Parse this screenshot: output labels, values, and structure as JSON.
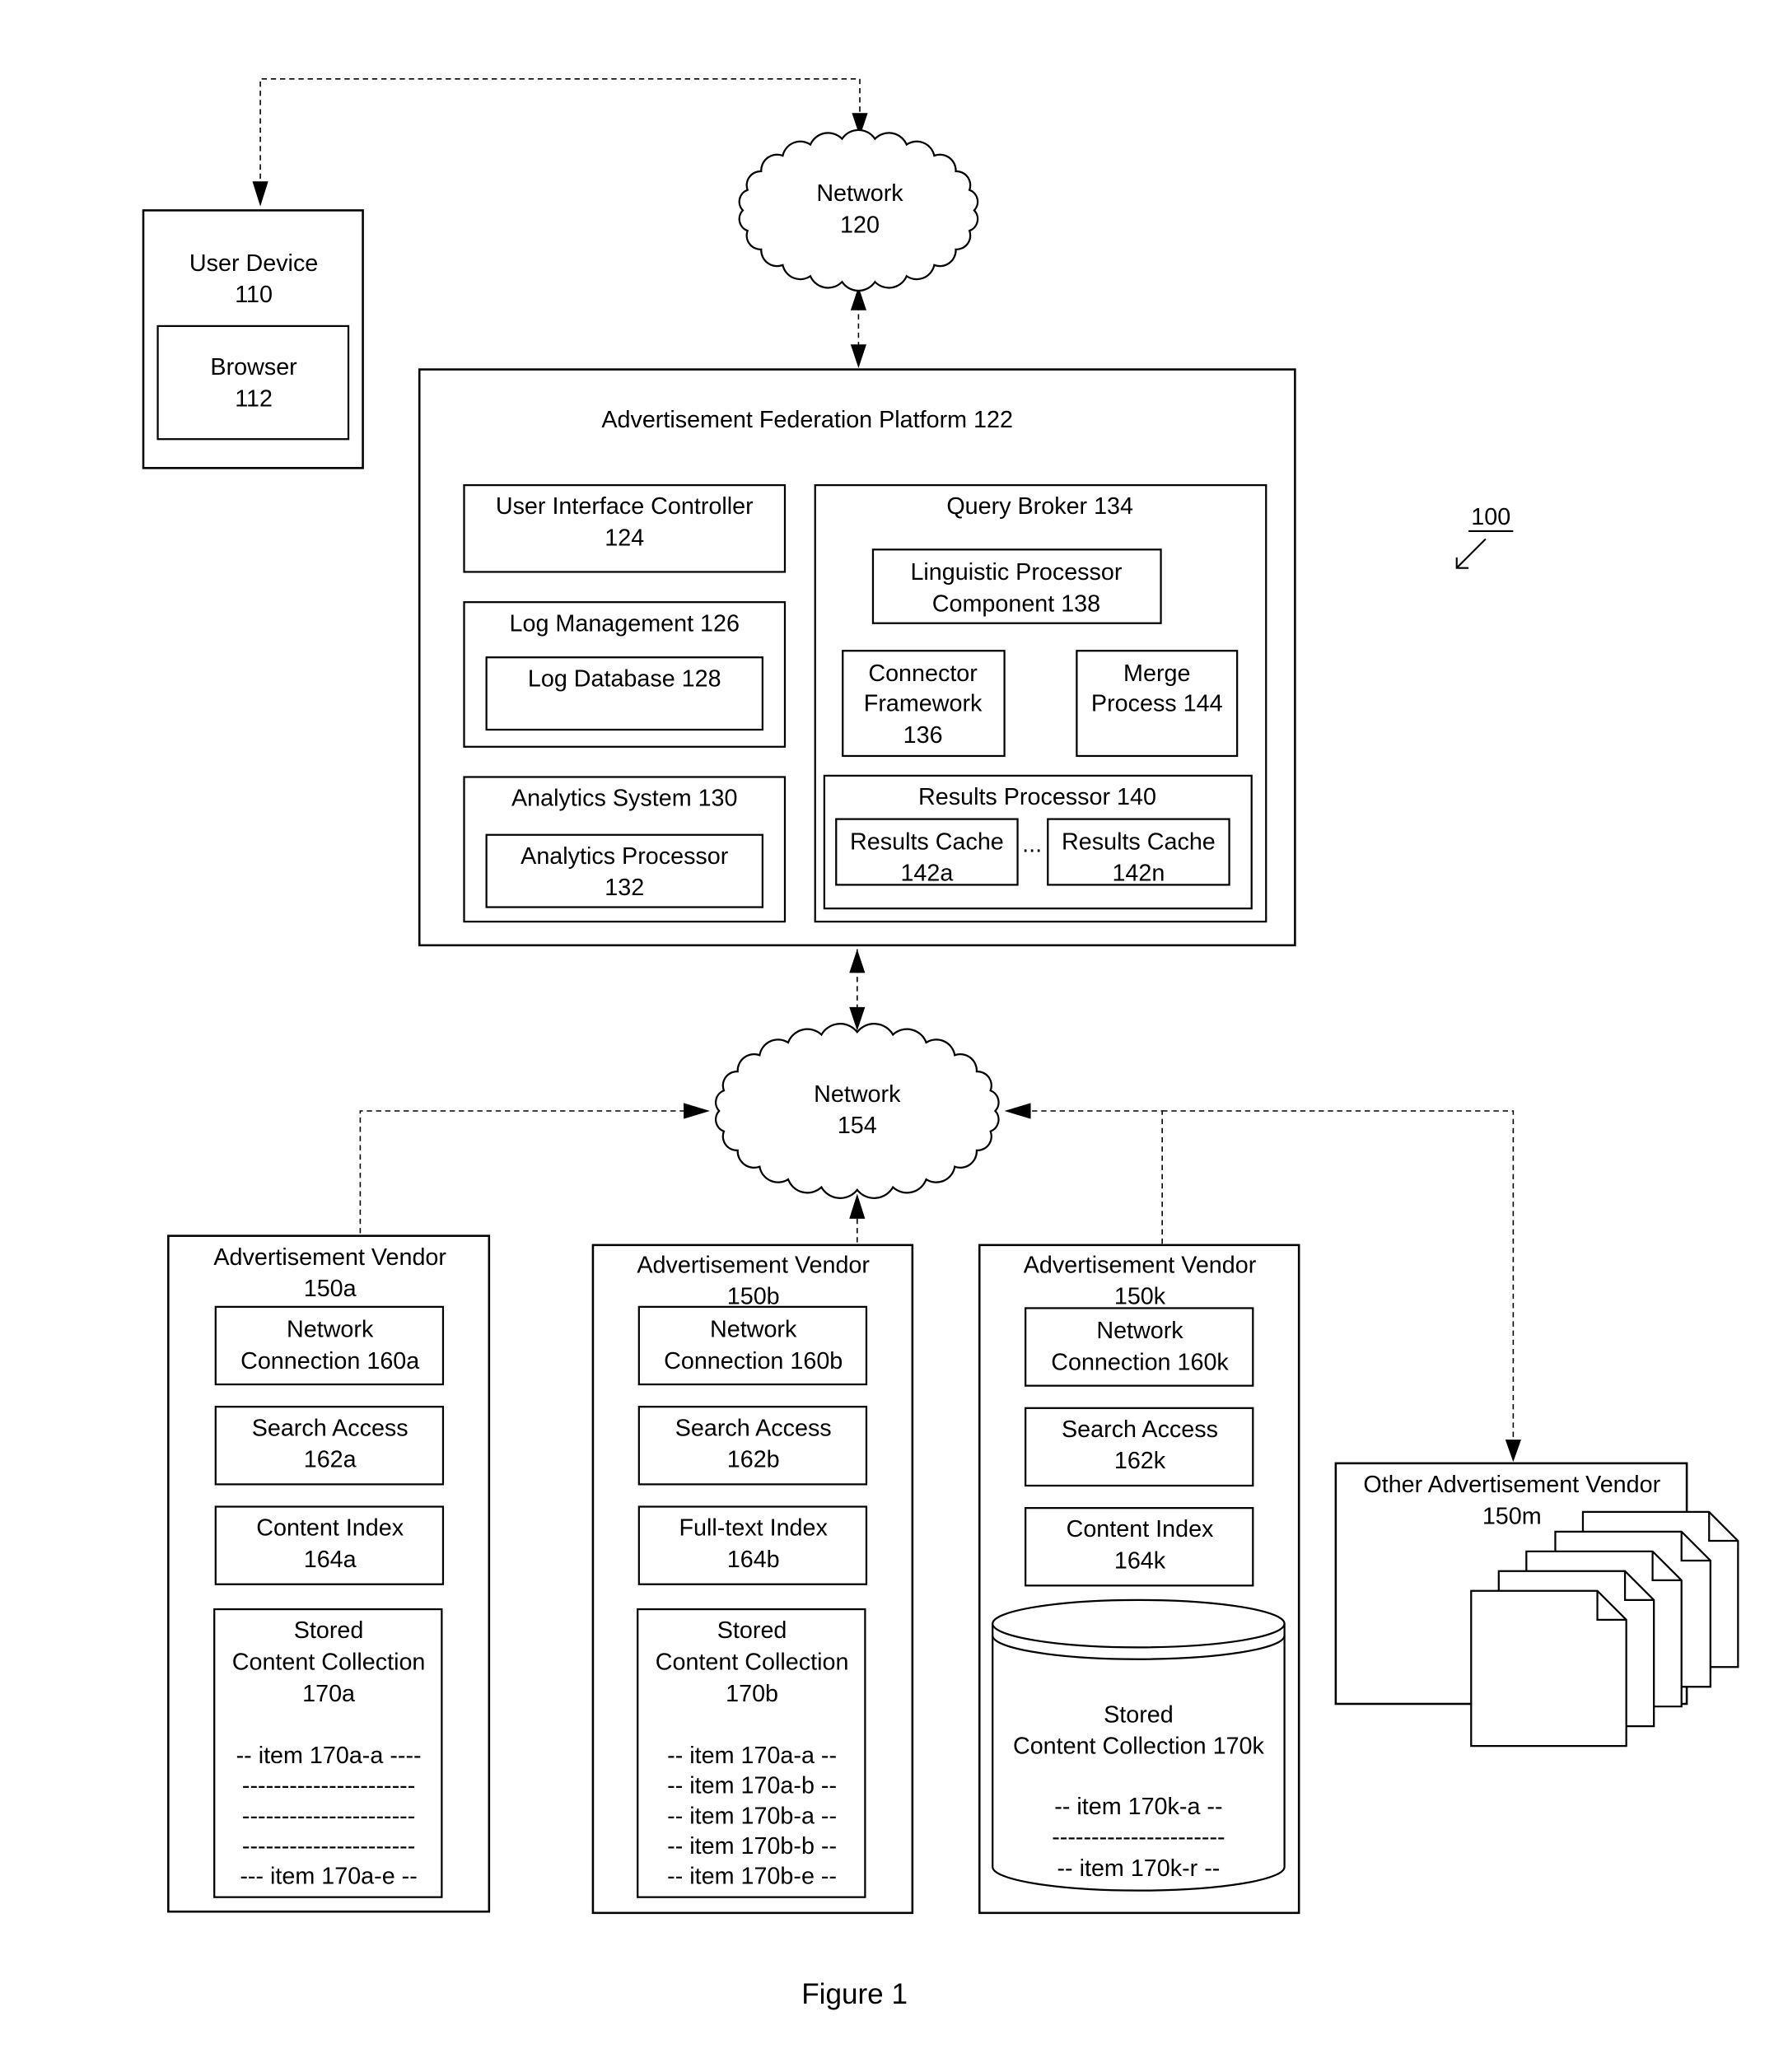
{
  "figure": {
    "label": "Figure 1",
    "reference_number": "100"
  },
  "user_device": {
    "title": "User Device",
    "number": "110",
    "browser": {
      "title": "Browser",
      "number": "112"
    }
  },
  "network_top": {
    "title": "Network",
    "number": "120"
  },
  "platform": {
    "title": "Advertisement Federation Platform 122",
    "ui_controller": {
      "line1": "User Interface Controller",
      "line2": "124"
    },
    "log_management": {
      "title": "Log Management 126",
      "log_database": "Log Database 128"
    },
    "analytics_system": {
      "title": "Analytics System 130",
      "processor": {
        "line1": "Analytics Processor",
        "line2": "132"
      }
    },
    "query_broker": {
      "title": "Query Broker 134",
      "linguistic": {
        "line1": "Linguistic Processor",
        "line2": "Component 138"
      },
      "connector": {
        "line1": "Connector",
        "line2": "Framework",
        "line3": "136"
      },
      "merge": {
        "line1": "Merge",
        "line2": "Process 144"
      },
      "results_processor": {
        "title": "Results Processor 140",
        "cache_a": {
          "line1": "Results Cache",
          "line2": "142a"
        },
        "ellipsis": "...",
        "cache_n": {
          "line1": "Results Cache",
          "line2": "142n"
        }
      }
    }
  },
  "network_bottom": {
    "title": "Network",
    "number": "154"
  },
  "vendors": [
    {
      "title": "Advertisement Vendor",
      "number": "150a",
      "network_connection": {
        "line1": "Network",
        "line2": "Connection 160a"
      },
      "search_access": {
        "line1": "Search Access",
        "line2": "162a"
      },
      "index": {
        "line1": "Content Index",
        "line2": "164a"
      },
      "collection": {
        "line1": "Stored",
        "line2": "Content Collection",
        "line3": "170a",
        "items": [
          "-- item 170a-a ----",
          "----------------------",
          "----------------------",
          "----------------------",
          "--- item 170a-e --"
        ]
      }
    },
    {
      "title": "Advertisement Vendor",
      "number": "150b",
      "network_connection": {
        "line1": "Network",
        "line2": "Connection 160b"
      },
      "search_access": {
        "line1": "Search Access",
        "line2": "162b"
      },
      "index": {
        "line1": "Full-text Index",
        "line2": "164b"
      },
      "collection": {
        "line1": "Stored",
        "line2": "Content Collection",
        "line3": "170b",
        "items": [
          "-- item 170a-a --",
          "-- item 170a-b --",
          "-- item 170b-a --",
          "-- item 170b-b --",
          "-- item 170b-e --"
        ]
      }
    },
    {
      "title": "Advertisement Vendor",
      "number": "150k",
      "network_connection": {
        "line1": "Network",
        "line2": "Connection 160k"
      },
      "search_access": {
        "line1": "Search Access",
        "line2": "162k"
      },
      "index": {
        "line1": "Content Index",
        "line2": "164k"
      },
      "collection": {
        "line1": "Stored",
        "line2": "Content Collection 170k",
        "items": [
          "-- item 170k-a --",
          "----------------------",
          "-- item 170k-r --"
        ]
      }
    }
  ],
  "other_vendor": {
    "title": "Other Advertisement Vendor",
    "number": "150m"
  }
}
